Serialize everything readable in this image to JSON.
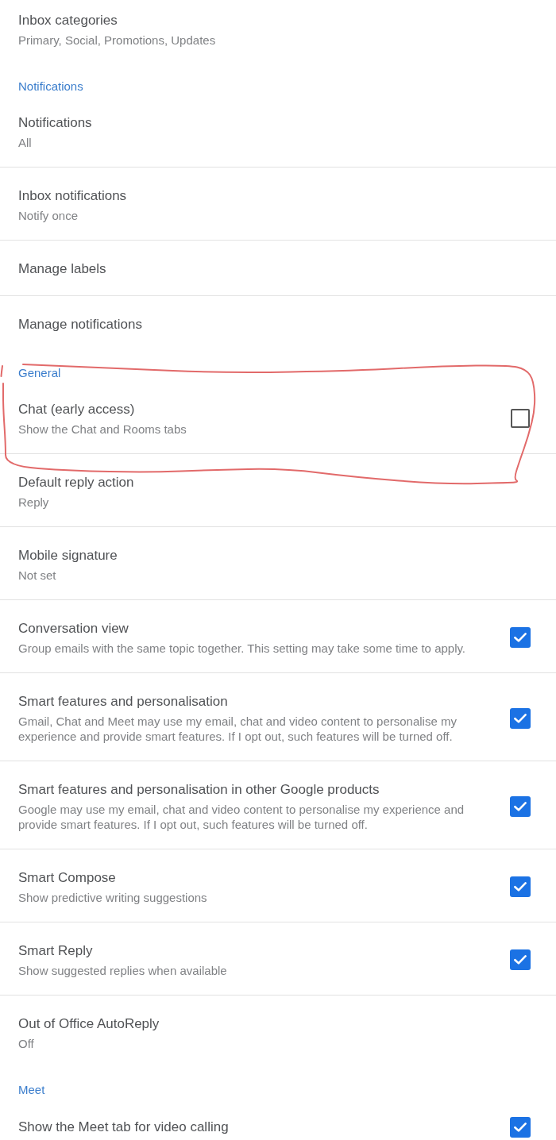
{
  "sections": [
    {
      "items": [
        {
          "kind": "link",
          "title": "Inbox categories",
          "summary": "Primary, Social, Promotions, Updates",
          "circled": false
        }
      ]
    },
    {
      "header": "Notifications",
      "items": [
        {
          "kind": "link",
          "title": "Notifications",
          "summary": "All",
          "circled": false
        },
        {
          "kind": "link",
          "title": "Inbox notifications",
          "summary": "Notify once",
          "circled": false
        },
        {
          "kind": "link",
          "title": "Manage labels",
          "circled": false
        },
        {
          "kind": "link",
          "title": "Manage notifications",
          "circled": false
        }
      ]
    },
    {
      "header": "General",
      "items": [
        {
          "kind": "checkbox",
          "title": "Chat (early access)",
          "summary": "Show the Chat and Rooms tabs",
          "checked": false,
          "circled": true
        },
        {
          "kind": "link",
          "title": "Default reply action",
          "summary": "Reply",
          "circled": false
        },
        {
          "kind": "link",
          "title": "Mobile signature",
          "summary": "Not set",
          "circled": false
        },
        {
          "kind": "checkbox",
          "title": "Conversation view",
          "summary": "Group emails with the same topic together. This setting may take some time to apply.",
          "checked": true,
          "circled": false
        },
        {
          "kind": "checkbox",
          "title": "Smart features and personalisation",
          "summary": "Gmail, Chat and Meet may use my email, chat and video content to personalise my experience and provide smart features. If I opt out, such features will be turned off.",
          "checked": true,
          "circled": false
        },
        {
          "kind": "checkbox",
          "title": "Smart features and personalisation in other Google products",
          "summary": "Google may use my email, chat and video content to personalise my experience and provide smart features. If I opt out, such features will be turned off.",
          "checked": true,
          "circled": false
        },
        {
          "kind": "checkbox",
          "title": "Smart Compose",
          "summary": "Show predictive writing suggestions",
          "checked": true,
          "circled": false
        },
        {
          "kind": "checkbox",
          "title": "Smart Reply",
          "summary": "Show suggested replies when available",
          "checked": true,
          "circled": false
        },
        {
          "kind": "link",
          "title": "Out of Office AutoReply",
          "summary": "Off",
          "circled": false
        }
      ]
    },
    {
      "header": "Meet",
      "items": [
        {
          "kind": "checkbox",
          "title": "Show the Meet tab for video calling",
          "checked": true,
          "circled": false
        }
      ]
    }
  ]
}
